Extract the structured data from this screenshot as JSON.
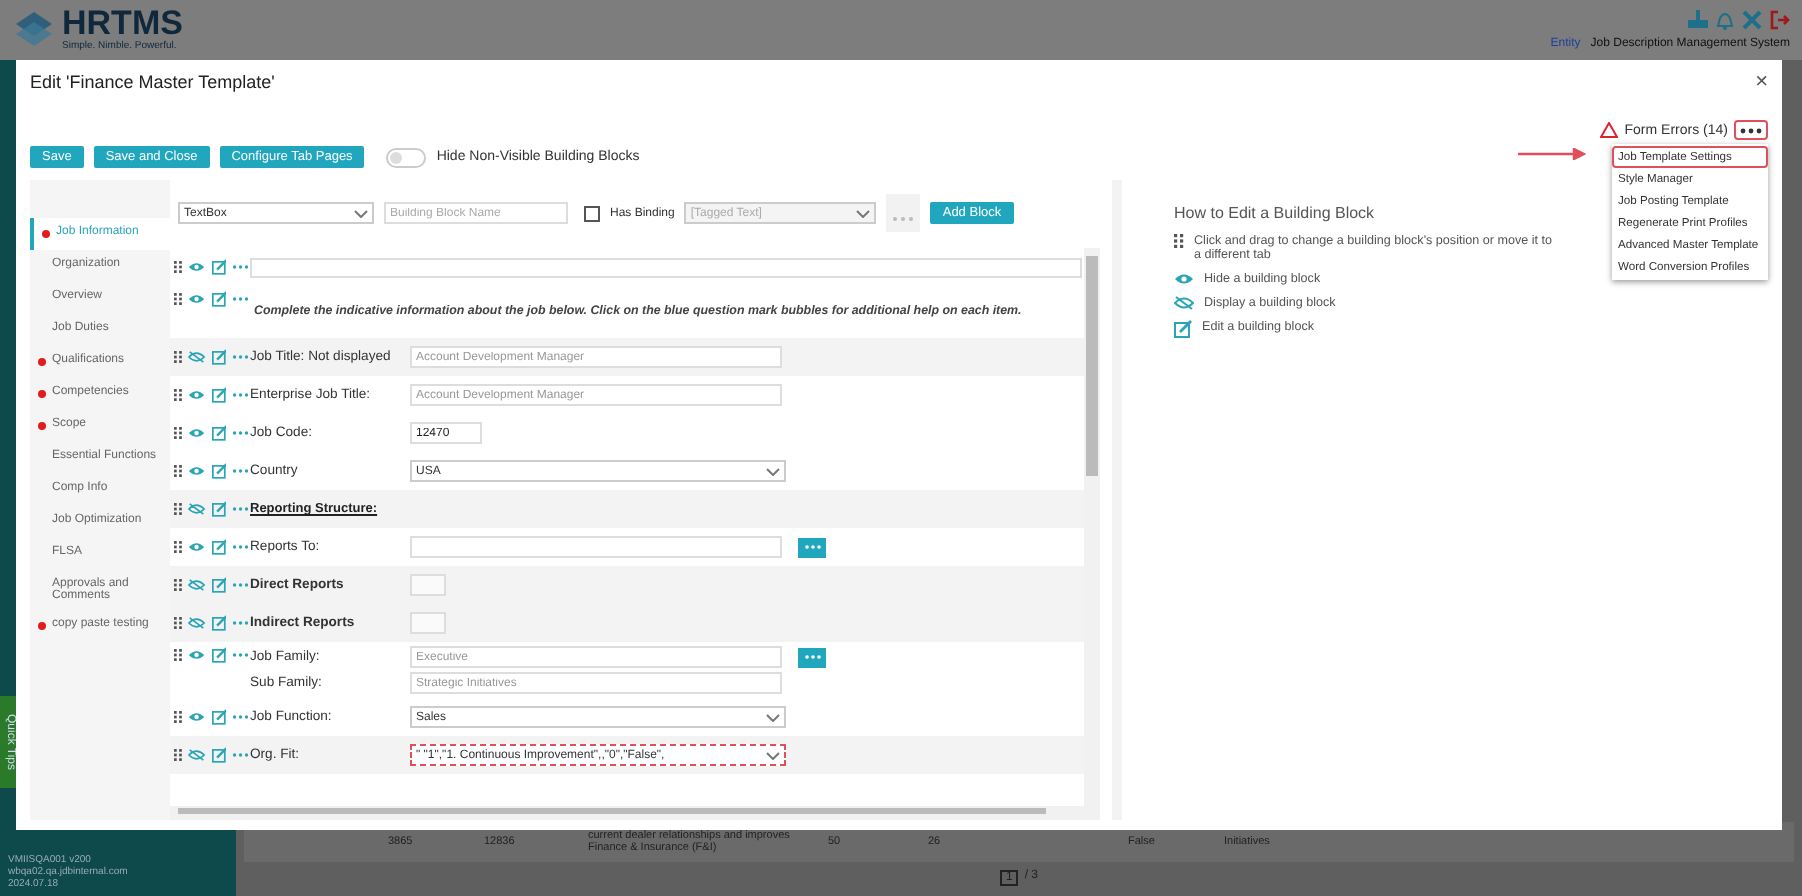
{
  "app": {
    "logo": "HRTMS",
    "tagline": "Simple. Nimble. Powerful.",
    "entity_link": "Entity",
    "system_name": "Job Description Management System",
    "quick_tips": "Quick Tips",
    "footer": [
      "VMIISQA001 v200",
      "wbqa02.qa.jdbinternal.com",
      "2024.07.18"
    ],
    "background_row": [
      "3865",
      "12836",
      "current dealer relationships and improves Finance & Insurance (F&I)",
      "50",
      "26",
      "False",
      "Initiatives"
    ],
    "pager": {
      "page": "1",
      "total": "/ 3"
    }
  },
  "dialog": {
    "title": "Edit 'Finance Master Template'",
    "close": "×",
    "form_errors": "Form Errors (14)",
    "menu": [
      {
        "label": "Job Template Settings",
        "selected": true
      },
      {
        "label": "Style Manager",
        "selected": false
      },
      {
        "label": "Job Posting Template",
        "selected": false
      },
      {
        "label": "Regenerate Print Profiles",
        "selected": false
      },
      {
        "label": "Advanced Master Template",
        "selected": false
      },
      {
        "label": "Word Conversion Profiles",
        "selected": false
      }
    ],
    "toolbar": [
      "Save",
      "Save and Close",
      "Configure Tab Pages"
    ],
    "hide_toggle": {
      "label": "Hide Non-Visible Building Blocks",
      "on": false
    },
    "tabs": [
      {
        "label": "Job Information",
        "selected": true,
        "has_error": true
      },
      {
        "label": "Organization",
        "selected": false,
        "has_error": false
      },
      {
        "label": "Overview",
        "selected": false,
        "has_error": false
      },
      {
        "label": "Job Duties",
        "selected": false,
        "has_error": false
      },
      {
        "label": "Qualifications",
        "selected": false,
        "has_error": true
      },
      {
        "label": "Competencies",
        "selected": false,
        "has_error": true
      },
      {
        "label": "Scope",
        "selected": false,
        "has_error": true
      },
      {
        "label": "Essential Functions",
        "selected": false,
        "has_error": false
      },
      {
        "label": "Comp Info",
        "selected": false,
        "has_error": false
      },
      {
        "label": "Job Optimization",
        "selected": false,
        "has_error": false
      },
      {
        "label": "FLSA",
        "selected": false,
        "has_error": false
      },
      {
        "label": "Approvals and Comments",
        "selected": false,
        "has_error": false
      },
      {
        "label": "copy paste testing",
        "selected": false,
        "has_error": true
      }
    ],
    "block_bar": {
      "type_value": "TextBox",
      "name_placeholder": "Building Block Name",
      "has_binding": {
        "label": "Has Binding",
        "checked": false
      },
      "binding_value": "[Tagged Text]",
      "add_button": "Add Block"
    },
    "blocks": [
      {
        "kind": "input",
        "hidden": false
      },
      {
        "kind": "note",
        "hidden": false,
        "text": "Complete the indicative information about the job below.  Click on the blue question mark bubbles for additional help on each item."
      },
      {
        "kind": "input",
        "hidden": true,
        "label": "Job Title: Not displayed",
        "value": "Account Development Manager",
        "disabled": true
      },
      {
        "kind": "input",
        "hidden": false,
        "label": "Enterprise Job Title:",
        "value": "Account Development Manager",
        "disabled": true
      },
      {
        "kind": "short",
        "hidden": false,
        "label": "Job Code:",
        "value": "12470"
      },
      {
        "kind": "select",
        "hidden": false,
        "label": "Country",
        "value": "USA",
        "error": false
      },
      {
        "kind": "heading",
        "hidden": true,
        "label": "Reporting Structure:"
      },
      {
        "kind": "lookup",
        "hidden": false,
        "label": "Reports To:"
      },
      {
        "kind": "box",
        "hidden": true,
        "label": "Direct Reports"
      },
      {
        "kind": "box",
        "hidden": true,
        "label": "Indirect Reports"
      },
      {
        "kind": "pair",
        "hidden": false,
        "label": "Job Family:",
        "value": "Executive",
        "label2": "Sub Family:",
        "value2": "Strategic Initiatives"
      },
      {
        "kind": "select",
        "hidden": false,
        "label": "Job Function:",
        "value": "Sales",
        "error": false
      },
      {
        "kind": "select",
        "hidden": true,
        "label": "Org. Fit:",
        "value": "\" \"1\",\"1. Continuous Improvement\",,\"0\",\"False\",",
        "error": true
      }
    ],
    "help": {
      "title": "How to Edit a Building Block",
      "items": [
        {
          "kind": "drag",
          "text": "Click and drag to change a building block's position or move it to a different tab"
        },
        {
          "kind": "hide",
          "text": "Hide a building block"
        },
        {
          "kind": "show",
          "text": "Display a building block"
        },
        {
          "kind": "edit",
          "text": "Edit a building block"
        }
      ]
    }
  }
}
